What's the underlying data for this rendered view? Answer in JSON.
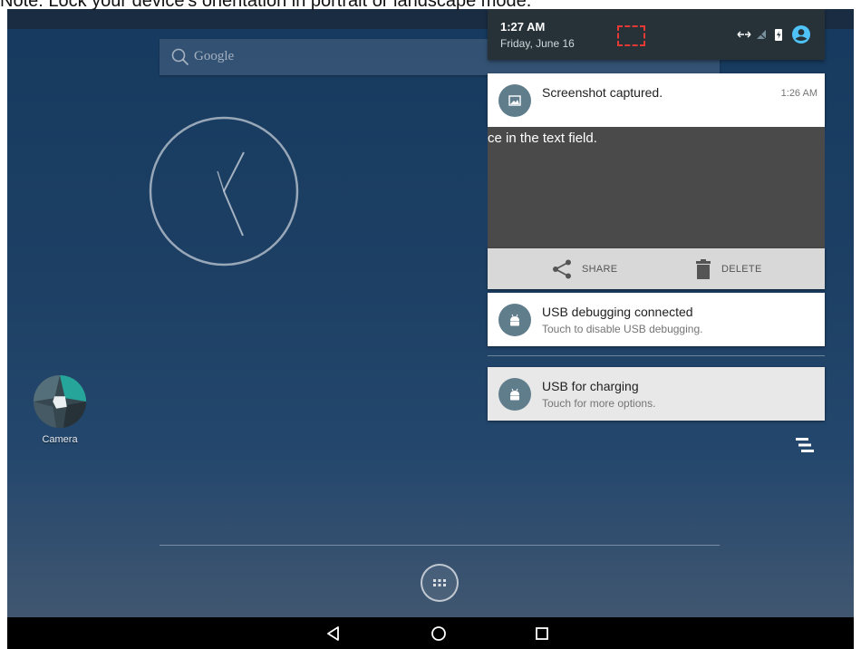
{
  "caption": {
    "text": "Note: Lock your device's orientation        in portrait or landscape mode."
  },
  "home": {
    "search_placeholder": "Google",
    "camera_label": "Camera"
  },
  "shade": {
    "time": "1:27 AM",
    "date": "Friday, June 16"
  },
  "notifications": {
    "screenshot": {
      "title": "Screenshot captured.",
      "time": "1:26 AM",
      "preview_text": "ce in the text field.",
      "share_label": "SHARE",
      "delete_label": "DELETE"
    },
    "usb_debugging": {
      "title": "USB debugging connected",
      "text": "Touch to disable USB debugging."
    },
    "usb_charging": {
      "title": "USB for charging",
      "text": "Touch for more options."
    }
  },
  "colors": {
    "shade_header": "#263238",
    "notification_icon_bg": "#607d8b",
    "cast_highlight": "#e53935",
    "profile_blue": "#4fc3f7"
  }
}
